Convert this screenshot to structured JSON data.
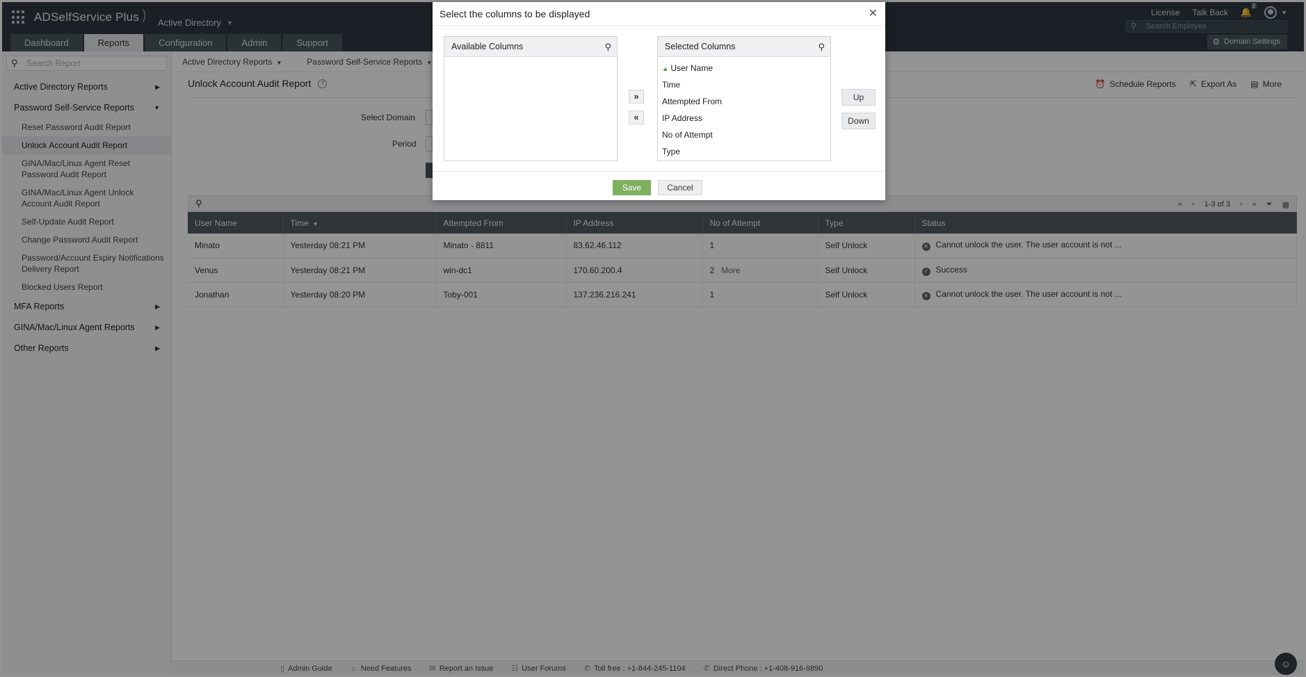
{
  "header": {
    "brand": "ADSelfService Plus",
    "directory_select": "Active Directory",
    "links": {
      "license": "License",
      "talk_back": "Talk Back"
    },
    "notification_count": "2",
    "employee_search_placeholder": "Search Employee",
    "domain_settings": "Domain Settings",
    "tabs": [
      {
        "label": "Dashboard"
      },
      {
        "label": "Reports"
      },
      {
        "label": "Configuration"
      },
      {
        "label": "Admin"
      },
      {
        "label": "Support"
      }
    ]
  },
  "sidebar": {
    "search_placeholder": "Search Report",
    "categories": {
      "active_directory": "Active Directory Reports",
      "password_self_service": "Password Self-Service Reports",
      "mfa": "MFA Reports",
      "gina_agent": "GINA/Mac/Linux Agent Reports",
      "other": "Other Reports"
    },
    "items": [
      {
        "label": "Reset Password Audit Report"
      },
      {
        "label": "Unlock Account Audit Report"
      },
      {
        "label": "GINA/Mac/Linux Agent Reset Password Audit Report"
      },
      {
        "label": "GINA/Mac/Linux Agent Unlock Account Audit Report"
      },
      {
        "label": "Self-Update Audit Report"
      },
      {
        "label": "Change Password Audit Report"
      },
      {
        "label": "Password/Account Expiry Notifications Delivery Report"
      },
      {
        "label": "Blocked Users Report"
      }
    ]
  },
  "main": {
    "breadcrumb": {
      "level1": "Active Directory Reports",
      "level2": "Password Self-Service Reports"
    },
    "report_title": "Unlock Account Audit Report",
    "actions": {
      "schedule": "Schedule Reports",
      "export": "Export As",
      "more": "More"
    },
    "form": {
      "select_domain_label": "Select Domain",
      "period_label": "Period"
    },
    "pager": {
      "range": "1-3 of 3"
    },
    "table": {
      "columns": [
        "User Name",
        "Time",
        "Attempted From",
        "IP Address",
        "No of Attempt",
        "Type",
        "Status"
      ],
      "rows": [
        {
          "user": "Minato",
          "time": "Yesterday 08:21 PM",
          "from": "Minato - 8811",
          "ip": "83.62.46.112",
          "attempts": "1",
          "more": "",
          "type": "Self Unlock",
          "status": "Cannot unlock the user. The user account is not ..."
        },
        {
          "user": "Venus",
          "time": "Yesterday 08:21 PM",
          "from": "win-dc1",
          "ip": "170.60.200.4",
          "attempts": "2",
          "more": "More",
          "type": "Self Unlock",
          "status": "Success"
        },
        {
          "user": "Jonathan",
          "time": "Yesterday 08:20 PM",
          "from": "Toby-001",
          "ip": "137.236.216.241",
          "attempts": "1",
          "more": "",
          "type": "Self Unlock",
          "status": "Cannot unlock the user. The user account is not ..."
        }
      ]
    }
  },
  "footer": {
    "admin_guide": "Admin Guide",
    "need_features": "Need Features",
    "report_issue": "Report an Issue",
    "user_forums": "User Forums",
    "toll_free": "Toll free : +1-844-245-1104",
    "direct_phone": "Direct Phone : +1-408-916-9890"
  },
  "modal": {
    "title": "Select the columns to be displayed",
    "available_title": "Available Columns",
    "selected_title": "Selected Columns",
    "selected_columns": [
      "User Name",
      "Time",
      "Attempted From",
      "IP Address",
      "No of Attempt",
      "Type"
    ],
    "move_right": "»",
    "move_left": "«",
    "up": "Up",
    "down": "Down",
    "save": "Save",
    "cancel": "Cancel"
  },
  "colors": {
    "header_bg": "#2d3840",
    "table_head_bg": "#505a61",
    "save_green": "#7db05f",
    "lock_green": "#4a9f3a"
  }
}
